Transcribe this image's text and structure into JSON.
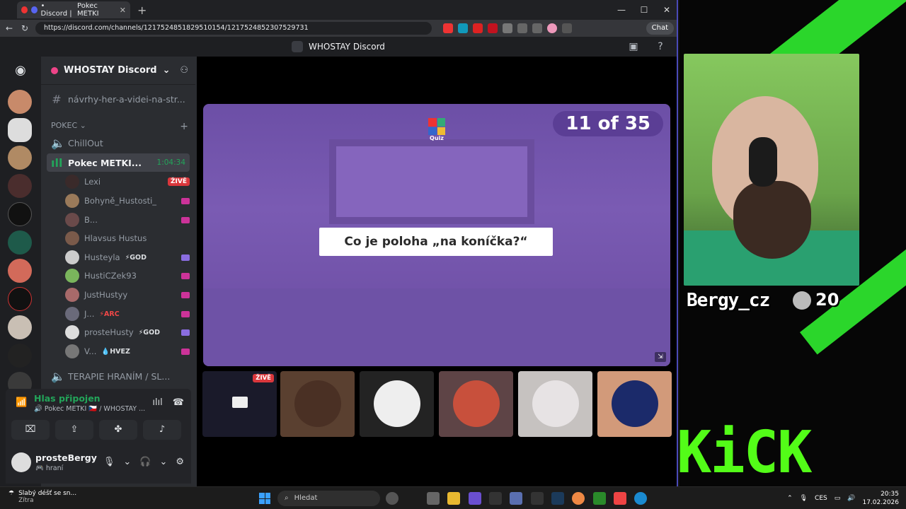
{
  "browser": {
    "tab_title": "• Discord |",
    "tab2_title": "Pokec METKI",
    "url": "https://discord.com/channels/1217524851829510154/1217524852307529731",
    "chat_label": "Chat"
  },
  "discord": {
    "title": "WHOSTAY Discord",
    "server_name": "WHOSTAY Discord",
    "channel_top": "návrhy-her-a-videi-na-str...",
    "category": "POKEC",
    "channel_chillout": "ChillOut",
    "channel_active": "Pokec METKI...",
    "call_timer": "1:04:34",
    "channel_bottom": "TERAPIE HRANÍM / SL...",
    "live_badge": "ŽIVĚ",
    "members": [
      {
        "name": "Lexi",
        "tag": ""
      },
      {
        "name": "Bohyně_Hustosti_",
        "tag": ""
      },
      {
        "name": "B...",
        "tag": ""
      },
      {
        "name": "Hlavsus Hustus",
        "tag": ""
      },
      {
        "name": "Husteyla",
        "tag": "⚡GOD"
      },
      {
        "name": "HustiCZek93",
        "tag": ""
      },
      {
        "name": "JustHustyy",
        "tag": ""
      },
      {
        "name": "J...",
        "tag": "⚡ARC"
      },
      {
        "name": "prosteHusty",
        "tag": "⚡GOD"
      },
      {
        "name": "V...",
        "tag": "💧HVEZ"
      }
    ],
    "voice": {
      "status": "Hlas připojen",
      "sub": "🔊 Pokec METKI 🇨🇿 / WHOSTAY ..."
    },
    "user": {
      "name": "prosteBergy",
      "status": "🎮 hraní"
    }
  },
  "activity": {
    "app_label": "Quiz",
    "counter": "11 of 35",
    "question": "Co je poloha „na koníčka?“"
  },
  "stream": {
    "streamer": "Bergy_cz",
    "count": "20",
    "brand": "KiCK"
  },
  "taskbar": {
    "weather_title": "Slabý déšť se sn...",
    "weather_sub": "Zítra",
    "search_placeholder": "Hledat",
    "lang": "CES",
    "time": "20:35",
    "date": "17.02.2026"
  }
}
